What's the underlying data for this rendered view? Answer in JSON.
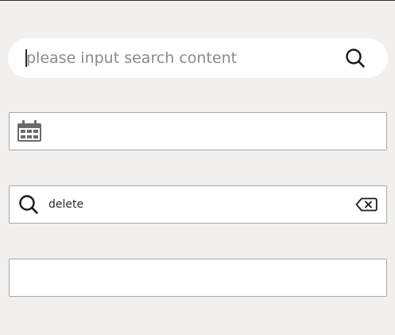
{
  "search": {
    "placeholder": "please input search content",
    "icon": "search-icon"
  },
  "date_field": {
    "icon": "calendar-icon",
    "value": ""
  },
  "delete_field": {
    "value": "delete",
    "leading_icon": "search-icon",
    "trailing_icon": "backspace-clear-icon"
  },
  "plain_field": {
    "value": ""
  },
  "colors": {
    "background": "#f1f0ee",
    "field_background": "#ffffff",
    "border": "#a9a9a9",
    "placeholder": "#8a8a8a",
    "icon": "#1a1a1a",
    "calendar_icon": "#6b6b6b"
  }
}
